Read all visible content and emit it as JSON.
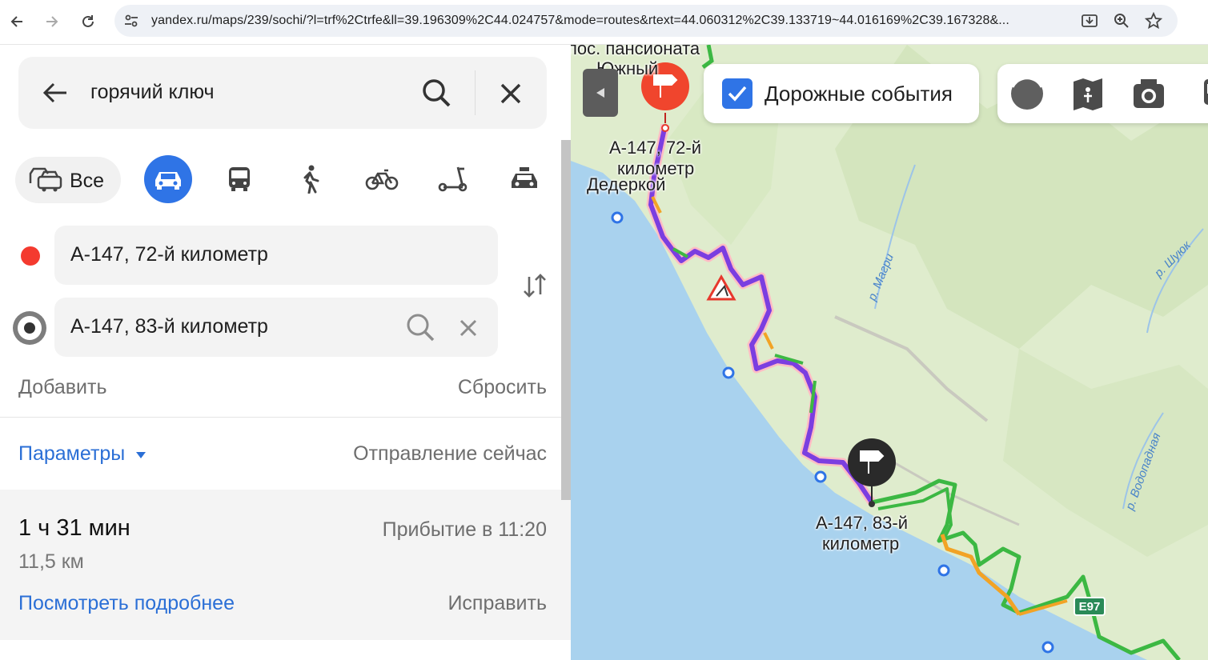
{
  "browser": {
    "url": "yandex.ru/maps/239/sochi/?l=trf%2Ctrfe&ll=39.196309%2C44.024757&mode=routes&rtext=44.060312%2C39.133719~44.016169%2C39.167328&...",
    "icons": [
      "back-arrow-icon",
      "forward-arrow-icon",
      "reload-icon",
      "site-settings-icon",
      "download-icon",
      "zoom-icon",
      "bookmark-star-icon"
    ]
  },
  "sidebar": {
    "search": {
      "query": "горячий ключ",
      "icons": [
        "back-arrow-icon",
        "search-icon",
        "close-icon"
      ]
    },
    "transport_modes": [
      {
        "id": "all",
        "label": "Все",
        "icon": "all-transport-icon"
      },
      {
        "id": "car",
        "label": "",
        "icon": "car-icon",
        "active": true
      },
      {
        "id": "bus",
        "label": "",
        "icon": "bus-icon"
      },
      {
        "id": "walk",
        "label": "",
        "icon": "pedestrian-icon"
      },
      {
        "id": "bike",
        "label": "",
        "icon": "bicycle-icon"
      },
      {
        "id": "scooter",
        "label": "",
        "icon": "scooter-icon"
      },
      {
        "id": "taxi",
        "label": "",
        "icon": "taxi-icon"
      }
    ],
    "waypoints": {
      "from": "А-147, 72-й километр",
      "to": "А-147, 83-й километр"
    },
    "add_label": "Добавить",
    "reset_label": "Сбросить",
    "params_label": "Параметры",
    "departure_label": "Отправление сейчас",
    "route": {
      "duration": "1 ч 31 мин",
      "arrival": "Прибытие в 11:20",
      "distance": "11,5 км",
      "details_label": "Посмотреть подробнее",
      "fix_label": "Исправить"
    }
  },
  "map": {
    "traffic_label": "Дорожные события",
    "traffic_checked": true,
    "labels": {
      "pansionat": "пос. пансионата",
      "yuzhny": "Южный",
      "start": "А-147, 72-й",
      "start2": "километр",
      "dederkoy": "Дедеркой",
      "end": "А-147, 83-й",
      "end2": "километр",
      "magri": "р. Магри",
      "shuyuk": "р. Шуюк",
      "vodopadnaya": "р. Водопадная",
      "highway": "E97"
    },
    "colors": {
      "sea": "#a9d2ee",
      "land": "#dfeccd",
      "route": "#7b3ee0",
      "traffic_green": "#3cb843",
      "traffic_orange": "#f2a325",
      "start_pin": "#f0452d",
      "end_pin": "#2a2a2a",
      "accent": "#2f74e6"
    }
  }
}
